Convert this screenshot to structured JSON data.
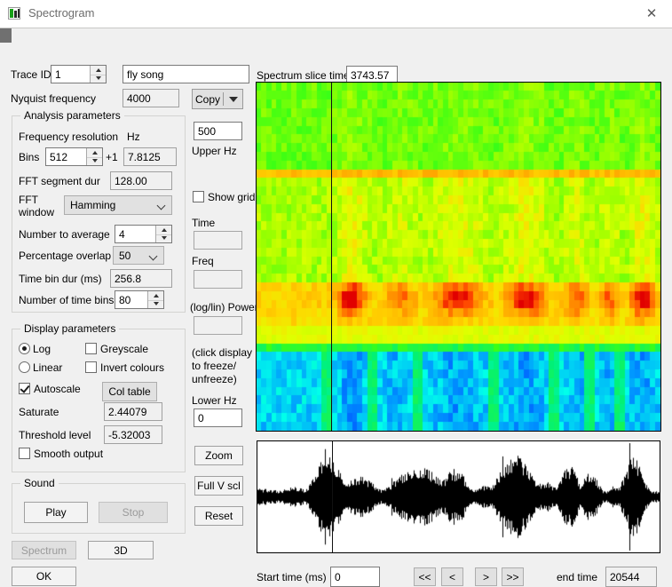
{
  "window": {
    "title": "Spectrogram",
    "icon": "spectrogram-icon",
    "close_label": "✕"
  },
  "top": {
    "trace_id_label": "Trace ID",
    "trace_id_value": "1",
    "trace_name_value": "fly song",
    "nyquist_label": "Nyquist frequency",
    "nyquist_value": "4000",
    "copy_label": "Copy"
  },
  "analysis": {
    "title": "Analysis parameters",
    "freq_resolution_label": "Frequency resolution",
    "hz_label": "Hz",
    "bins_label": "Bins",
    "bins_value": "512",
    "plus_one_label": "+1",
    "freq_resolution_value": "7.8125",
    "fft_segment_label": "FFT segment dur",
    "fft_segment_value": "128.00",
    "fft_window_label": "FFT\nwindow",
    "fft_window_label_line1": "FFT",
    "fft_window_label_line2": "window",
    "fft_window_value": "Hamming",
    "num_average_label": "Number to average",
    "num_average_value": "4",
    "pct_overlap_label": "Percentage overlap",
    "pct_overlap_value": "50",
    "time_bin_dur_label": "Time bin dur (ms)",
    "time_bin_dur_value": "256.8",
    "num_time_bins_label": "Number of time bins",
    "num_time_bins_value": "80"
  },
  "display": {
    "title": "Display parameters",
    "log_label": "Log",
    "linear_label": "Linear",
    "greyscale_label": "Greyscale",
    "invert_label": "Invert colours",
    "autoscale_label": "Autoscale",
    "col_table_label": "Col table",
    "saturate_label": "Saturate",
    "saturate_value": "2.44079",
    "threshold_label": "Threshold level",
    "threshold_value": "-5.32003",
    "smooth_label": "Smooth output",
    "scale_selected": "Log",
    "greyscale_checked": false,
    "invert_checked": false,
    "autoscale_checked": true,
    "smooth_checked": false
  },
  "sound": {
    "title": "Sound",
    "play_label": "Play",
    "stop_label": "Stop",
    "stop_enabled": false
  },
  "bottom_left": {
    "spectrum_label": "Spectrum",
    "spectrum_enabled": false,
    "threed_label": "3D",
    "ok_label": "OK"
  },
  "middle": {
    "upper_hz_value": "500",
    "upper_hz_label": "Upper Hz",
    "show_grid_label": "Show grid",
    "show_grid_checked": false,
    "time_label": "Time",
    "time_value": "",
    "freq_label": "Freq",
    "freq_value": "",
    "power_label": "(log/lin) Power",
    "power_value": "",
    "hint_line1": "(click display",
    "hint_line2": "to freeze/",
    "hint_line3": "unfreeze)",
    "lower_hz_label": "Lower Hz",
    "lower_hz_value": "0",
    "zoom_label": "Zoom",
    "full_v_scl_label": "Full V scl",
    "reset_label": "Reset"
  },
  "spectrogram": {
    "slice_time_label": "Spectrum slice time",
    "slice_time_value": "3743.57",
    "cursor_fraction": 0.185
  },
  "timeline": {
    "start_time_label": "Start time (ms)",
    "start_time_value": "0",
    "rew_all_label": "<<",
    "rew_label": "<",
    "fwd_label": ">",
    "fwd_all_label": ">>",
    "end_time_label": "end time",
    "end_time_value": "20544"
  },
  "colors": {
    "window_bg": "#f0f0f0",
    "title_bg": "#ffffff",
    "title_text": "#6d6d6d",
    "button_face": "#e1e1e1",
    "field_bg": "#ffffff",
    "disabled_text": "#9a9a9a",
    "cursor_line": "#111111",
    "waveform": "#000000"
  }
}
